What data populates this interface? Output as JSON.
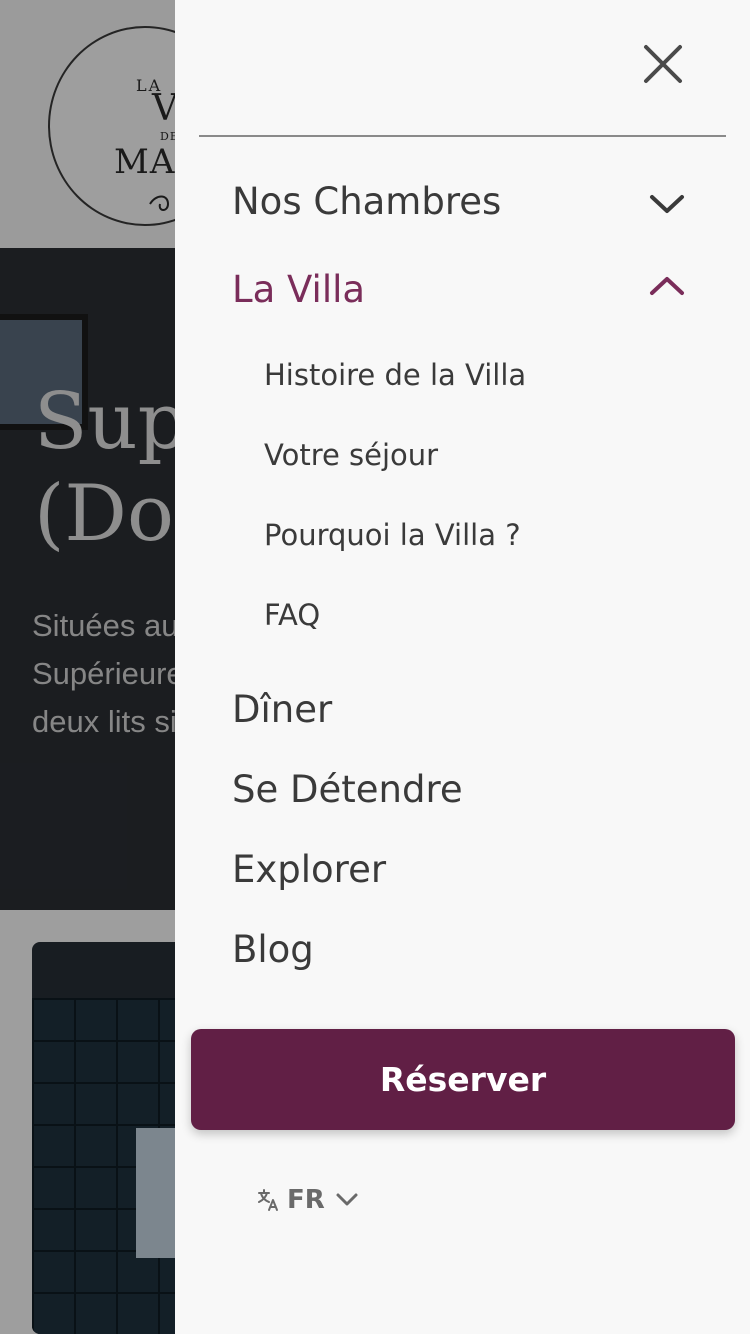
{
  "background": {
    "logo": {
      "la": "LA",
      "villa": "VILLA",
      "de": "DE",
      "mazan": "MAZAN"
    },
    "hero": {
      "title_line1": "Supérieure",
      "title_line2": "(Double)",
      "text": "Situées au premier étage, les chambres Supérieures disposent des lits confortables ou de deux lits simples"
    }
  },
  "drawer": {
    "close_icon": "close-icon",
    "nav": [
      {
        "label": "Nos Chambres",
        "expanded": false
      },
      {
        "label": "La Villa",
        "expanded": true,
        "active": true,
        "children": [
          "Histoire de la Villa",
          "Votre séjour",
          "Pourquoi la Villa ?",
          "FAQ"
        ]
      },
      {
        "label": "Dîner"
      },
      {
        "label": "Se Détendre"
      },
      {
        "label": "Explorer"
      },
      {
        "label": "Blog"
      }
    ],
    "reserve_label": "Réserver",
    "language": {
      "code": "FR",
      "icon": "translate-icon"
    }
  },
  "colors": {
    "accent": "#611f45",
    "active_text": "#7a2d5a",
    "drawer_bg": "#f8f8f8",
    "text": "#3a3a3a"
  }
}
